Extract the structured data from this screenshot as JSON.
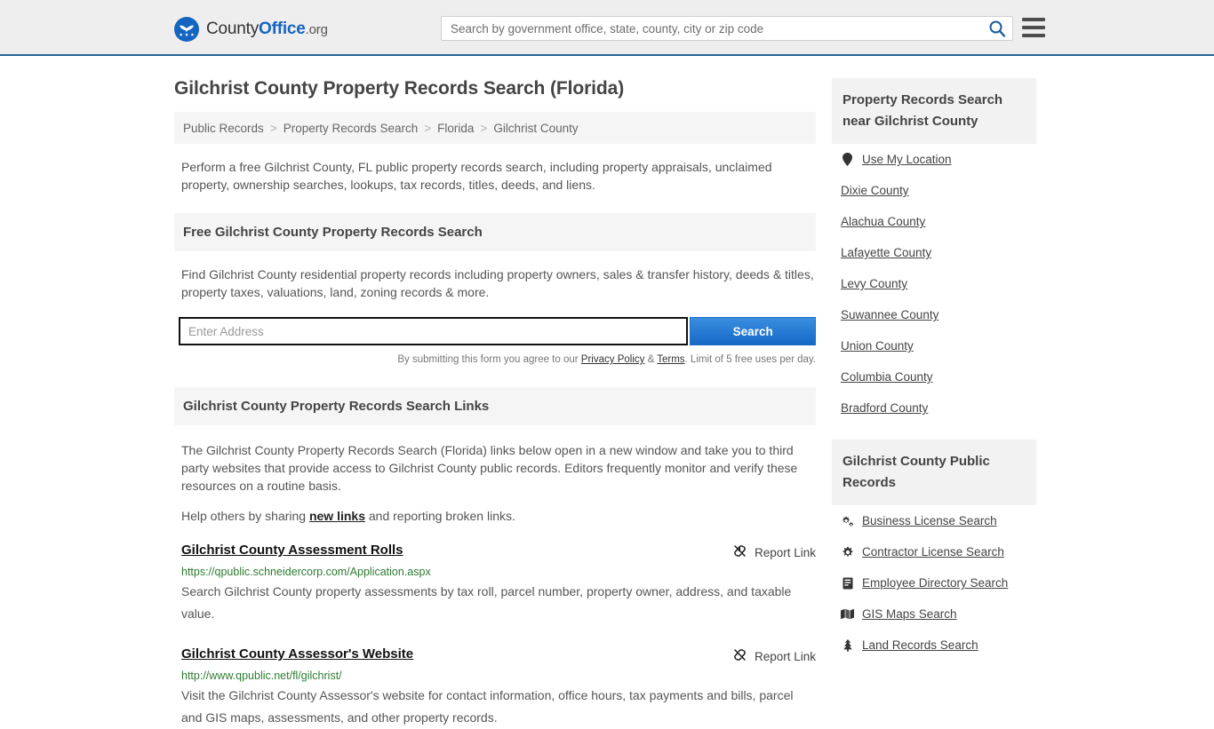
{
  "header": {
    "brand": {
      "part1": "County",
      "part2": "Office",
      "part3": ".org",
      "logo_icon": "eagle-stars-logo"
    },
    "search_placeholder": "Search by government office, state, county, city or zip code",
    "search_value": "",
    "search_icon": "search-icon",
    "menu_icon": "hamburger-menu-icon"
  },
  "main": {
    "page_title": "Gilchrist County Property Records Search (Florida)",
    "breadcrumb": [
      {
        "label": "Public Records"
      },
      {
        "label": "Property Records Search"
      },
      {
        "label": "Florida"
      },
      {
        "label": "Gilchrist County"
      }
    ],
    "breadcrumb_separator": ">",
    "intro": "Perform a free Gilchrist County, FL public property records search, including property appraisals, unclaimed property, ownership searches, lookups, tax records, titles, deeds, and liens.",
    "search_section": {
      "heading": "Free Gilchrist County Property Records Search",
      "description": "Find Gilchrist County residential property records including property owners, sales & transfer history, deeds & titles, property taxes, valuations, land, zoning records & more.",
      "input_placeholder": "Enter Address",
      "input_value": "",
      "submit_label": "Search",
      "disclaimer_prefix": "By submitting this form you agree to our ",
      "privacy_label": "Privacy Policy",
      "disclaimer_amp": " & ",
      "terms_label": "Terms",
      "disclaimer_suffix": ". Limit of 5 free uses per day."
    },
    "links_section": {
      "heading": "Gilchrist County Property Records Search Links",
      "paragraph": "The Gilchrist County Property Records Search (Florida) links below open in a new window and take you to third party websites that provide access to Gilchrist County public records. Editors frequently monitor and verify these resources on a routine basis.",
      "help_prefix": "Help others by sharing ",
      "help_link": "new links",
      "help_suffix": " and reporting broken links.",
      "report_label": "Report Link",
      "report_icon": "broken-link-icon",
      "items": [
        {
          "title": "Gilchrist County Assessment Rolls",
          "url": "https://qpublic.schneidercorp.com/Application.aspx",
          "description": "Search Gilchrist County property assessments by tax roll, parcel number, property owner, address, and taxable value."
        },
        {
          "title": "Gilchrist County Assessor's Website",
          "url": "http://www.qpublic.net/fl/gilchrist/",
          "description": "Visit the Gilchrist County Assessor's website for contact information, office hours, tax payments and bills, parcel and GIS maps, assessments, and other property records."
        }
      ]
    }
  },
  "sidebar": {
    "nearby": {
      "heading": "Property Records Search near Gilchrist County",
      "items": [
        {
          "label": "Use My Location",
          "icon": "map-pin-icon"
        },
        {
          "label": "Dixie County",
          "icon": ""
        },
        {
          "label": "Alachua County",
          "icon": ""
        },
        {
          "label": "Lafayette County",
          "icon": ""
        },
        {
          "label": "Levy County",
          "icon": ""
        },
        {
          "label": "Suwannee County",
          "icon": ""
        },
        {
          "label": "Union County",
          "icon": ""
        },
        {
          "label": "Columbia County",
          "icon": ""
        },
        {
          "label": "Bradford County",
          "icon": ""
        }
      ]
    },
    "public_records": {
      "heading": "Gilchrist County Public Records",
      "items": [
        {
          "label": "Business License Search",
          "icon": "cogs-icon"
        },
        {
          "label": "Contractor License Search",
          "icon": "cog-icon"
        },
        {
          "label": "Employee Directory Search",
          "icon": "book-icon"
        },
        {
          "label": "GIS Maps Search",
          "icon": "map-icon"
        },
        {
          "label": "Land Records Search",
          "icon": "tree-icon"
        }
      ]
    }
  },
  "colors": {
    "brand_blue": "#1565c0",
    "header_bg": "#eeeeee",
    "header_border": "#2a6496",
    "band_bg": "#f5f5f5",
    "url_green": "#2e7d32",
    "button_blue": "#1668c6"
  }
}
